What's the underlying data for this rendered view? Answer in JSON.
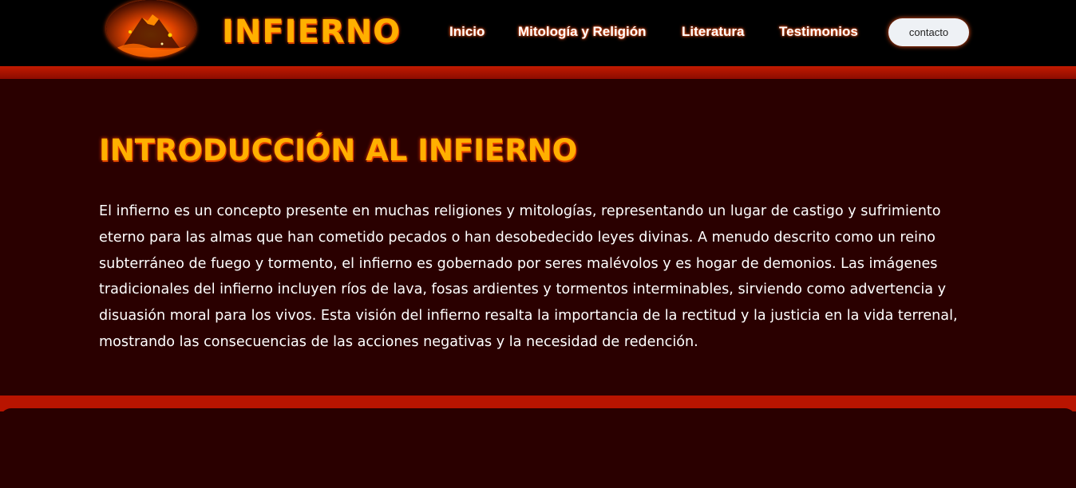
{
  "nav": {
    "logo_alt": "lava volcano logo",
    "site_title": "INFIERNO",
    "links": [
      "Inicio",
      "Mitología y Religión",
      "Literatura",
      "Testimonios"
    ],
    "contact_label": "contacto"
  },
  "intro": {
    "title": "INTRODUCCIÓN AL INFIERNO",
    "body": "El infierno es un concepto presente en muchas religiones y mitologías, representando un lugar de castigo y sufrimiento eterno para las almas que han cometido pecados o han desobedecido leyes divinas. A menudo descrito como un reino subterráneo de fuego y tormento, el infierno es gobernado por seres malévolos y es hogar de demonios. Las imágenes tradicionales del infierno incluyen ríos de lava, fosas ardientes y tormentos interminables, sirviendo como advertencia y disuasión moral para los vivos. Esta visión del infierno resalta la importancia de la rectitud y la justicia en la vida terrenal, mostrando las consecuencias de las acciones negativas y la necesidad de redención."
  },
  "colors": {
    "page_bg": "#2a0000",
    "nav_bg": "#000000",
    "accent_red": "#b81400",
    "title_orange": "#ffb000",
    "glow": "#ff3a00"
  }
}
